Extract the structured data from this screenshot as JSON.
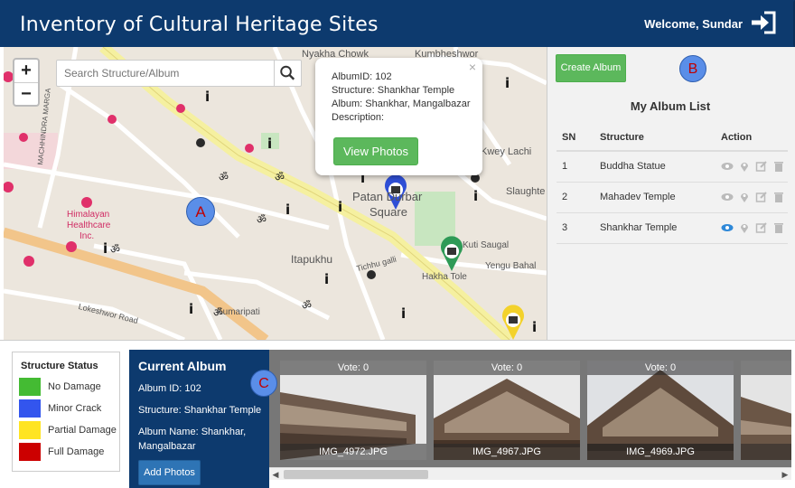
{
  "header": {
    "title": "Inventory of Cultural Heritage Sites",
    "welcome": "Welcome, Sundar"
  },
  "map": {
    "search_placeholder": "Search Structure/Album",
    "zoom_in": "+",
    "zoom_out": "−",
    "labels": {
      "nyakha_chowk": "Nyakha Chowk",
      "kumbheshwor": "Kumbheshwor",
      "machhindra_marga": "MACHHINDRA MARGA",
      "himalayan": "Himalayan",
      "healthcare": "Healthcare",
      "inc": "Inc.",
      "patan": "Patan Durbar",
      "square": "Square",
      "itapukhu": "Itapukhu",
      "kutisaugal": "Kuti Saugal",
      "yengu": "Yengu Bahal",
      "hakha": "Hakha Tole",
      "kumaripati": "Kumaripati",
      "lokeshwor": "Lokeshwor Road",
      "tichhu": "Tichhu galli",
      "kwey": "Kwey Lachi",
      "slaughter": "Slaughte",
      "marker_a": "A"
    },
    "popup": {
      "album_id": "AlbumID: 102",
      "structure": "Structure: Shankhar Temple",
      "album": "Album: Shankhar, Mangalbazar",
      "description": "Description:",
      "close": "×",
      "view_button": "View Photos"
    }
  },
  "panel": {
    "create_button": "Create Album",
    "marker_b": "B",
    "list_title": "My Album List",
    "columns": [
      "SN",
      "Structure",
      "Action"
    ],
    "rows": [
      {
        "sn": "1",
        "structure": "Buddha Statue"
      },
      {
        "sn": "2",
        "structure": "Mahadev Temple"
      },
      {
        "sn": "3",
        "structure": "Shankhar Temple"
      }
    ]
  },
  "legend": {
    "title": "Structure Status",
    "items": [
      {
        "label": "No Damage",
        "color": "#44bb33"
      },
      {
        "label": "Minor Crack",
        "color": "#3355ee"
      },
      {
        "label": "Partial Damage",
        "color": "#ffe422"
      },
      {
        "label": "Full Damage",
        "color": "#cc0000"
      }
    ]
  },
  "current_album": {
    "title": "Current Album",
    "album_id": "Album ID: 102",
    "structure": "Structure: Shankhar Temple",
    "album_name": "Album Name: Shankhar, Mangalbazar",
    "add_button": "Add Photos",
    "marker_c": "C"
  },
  "photos": [
    {
      "vote": "Vote: 0",
      "name": "IMG_4972.JPG"
    },
    {
      "vote": "Vote: 0",
      "name": "IMG_4967.JPG"
    },
    {
      "vote": "Vote: 0",
      "name": "IMG_4969.JPG"
    }
  ],
  "colors": {
    "header_bg": "#0d3a6e",
    "button_green": "#5cb85c",
    "button_blue": "#2e74b5",
    "marker_circle": "#5a8ee8",
    "marker_text": "#c00000"
  }
}
